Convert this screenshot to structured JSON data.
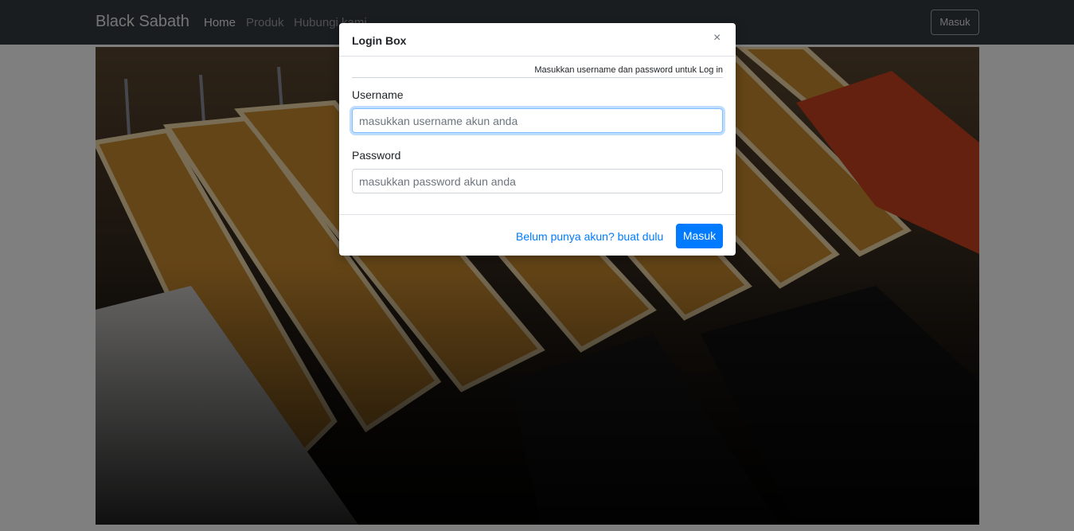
{
  "navbar": {
    "brand": "Black Sabath",
    "links": [
      "Home",
      "Produk",
      "Hubungi kami"
    ],
    "login_button": "Masuk"
  },
  "modal": {
    "title": "Login Box",
    "close_symbol": "×",
    "subtitle": "Masukkan username dan password untuk Log in",
    "username_label": "Username",
    "username_placeholder": "masukkan username akun anda",
    "password_label": "Password",
    "password_placeholder": "masukkan password akun anda",
    "register_link": "Belum punya akun? buat dulu",
    "submit_button": "Masuk"
  },
  "colors": {
    "navbar": "#343a40",
    "primary": "#007bff",
    "backdrop": "rgba(0,0,0,0.5)"
  }
}
